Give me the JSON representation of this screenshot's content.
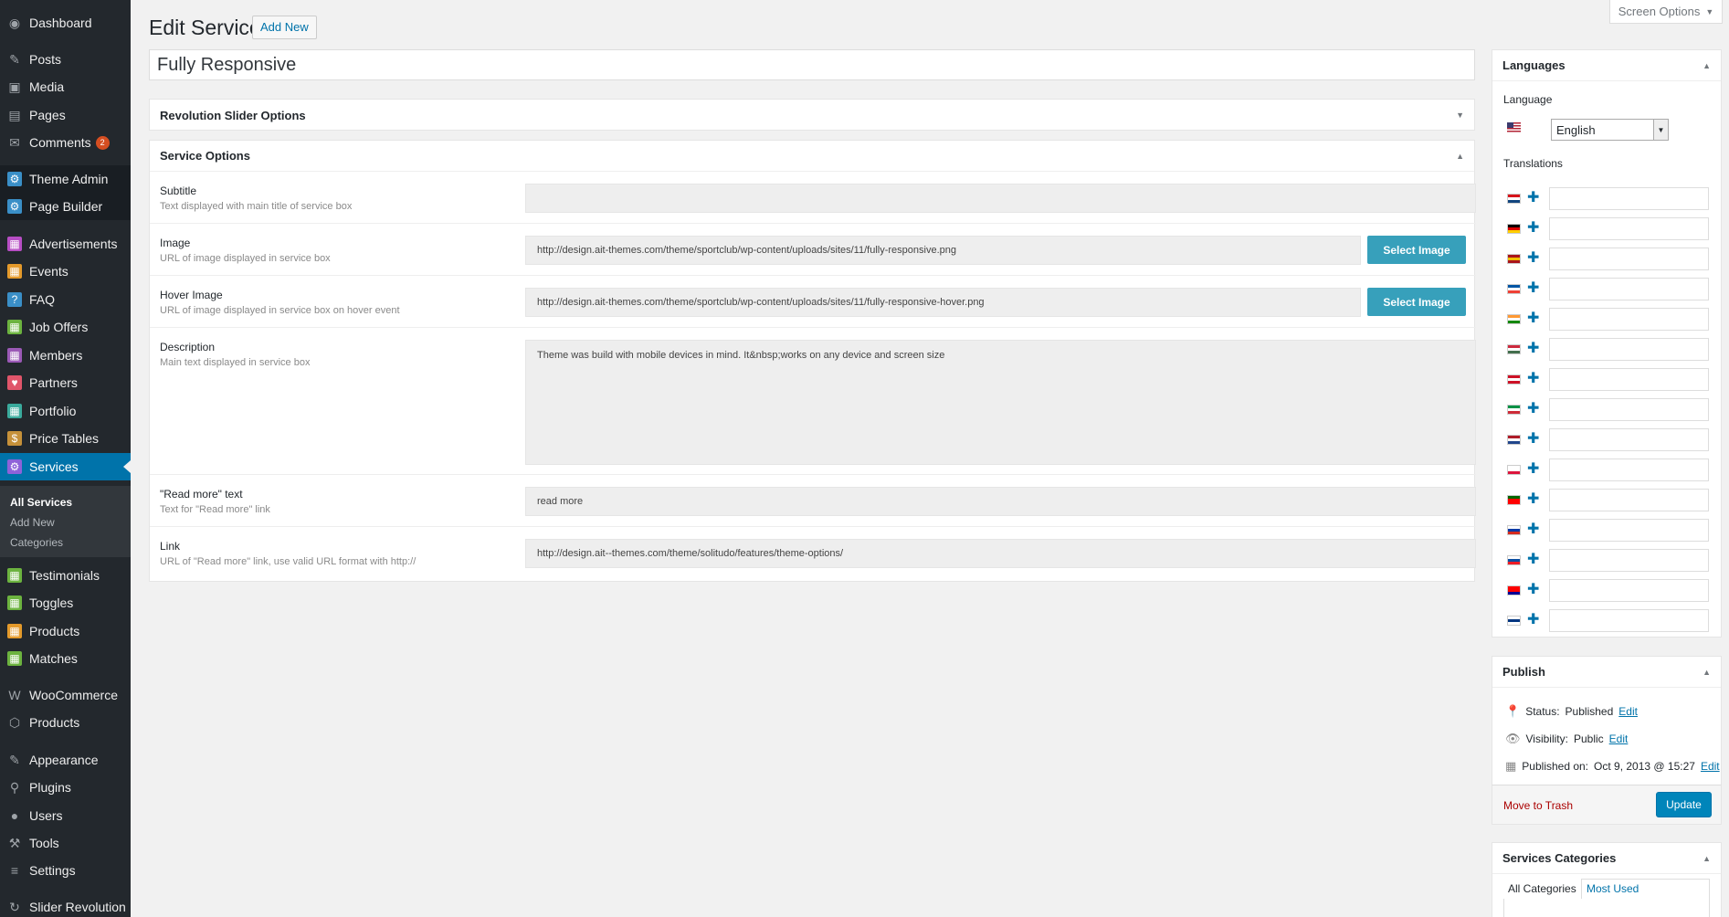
{
  "sidebar": {
    "items": [
      {
        "label": "Dashboard",
        "icon": "dashboard-icon",
        "color": "#9ea3a8"
      },
      {
        "label": "Posts",
        "icon": "pin-icon",
        "color": "#9ea3a8"
      },
      {
        "label": "Media",
        "icon": "media-icon",
        "color": "#9ea3a8"
      },
      {
        "label": "Pages",
        "icon": "pages-icon",
        "color": "#9ea3a8"
      },
      {
        "label": "Comments",
        "icon": "comments-icon",
        "color": "#9ea3a8",
        "badge": "2"
      },
      {
        "label": "Theme Admin",
        "icon": "theme-admin-icon",
        "color": "#3a8fc7"
      },
      {
        "label": "Page Builder",
        "icon": "page-builder-icon",
        "color": "#3a8fc7"
      },
      {
        "label": "Advertisements",
        "icon": "advertisements-icon",
        "color": "#b74ec4"
      },
      {
        "label": "Events",
        "icon": "events-icon",
        "color": "#e49a2b"
      },
      {
        "label": "FAQ",
        "icon": "faq-icon",
        "color": "#3a8fc7"
      },
      {
        "label": "Job Offers",
        "icon": "job-offers-icon",
        "color": "#6cb33f"
      },
      {
        "label": "Members",
        "icon": "members-icon",
        "color": "#9b59b6"
      },
      {
        "label": "Partners",
        "icon": "partners-icon",
        "color": "#e0556a"
      },
      {
        "label": "Portfolio",
        "icon": "portfolio-icon",
        "color": "#3aaa9c"
      },
      {
        "label": "Price Tables",
        "icon": "price-tables-icon",
        "color": "#c6913a"
      },
      {
        "label": "Services",
        "icon": "services-icon",
        "color": "#8e62d9"
      },
      {
        "label": "Testimonials",
        "icon": "testimonials-icon",
        "color": "#6cb33f"
      },
      {
        "label": "Toggles",
        "icon": "toggles-icon",
        "color": "#6cb33f"
      },
      {
        "label": "Products",
        "icon": "products-icon",
        "color": "#e49a2b"
      },
      {
        "label": "Matches",
        "icon": "matches-icon",
        "color": "#6cb33f"
      },
      {
        "label": "WooCommerce",
        "icon": "woocommerce-icon",
        "color": "#9ea3a8"
      },
      {
        "label": "Products",
        "icon": "box-icon",
        "color": "#9ea3a8"
      },
      {
        "label": "Appearance",
        "icon": "appearance-icon",
        "color": "#9ea3a8"
      },
      {
        "label": "Plugins",
        "icon": "plugins-icon",
        "color": "#9ea3a8"
      },
      {
        "label": "Users",
        "icon": "users-icon",
        "color": "#9ea3a8"
      },
      {
        "label": "Tools",
        "icon": "tools-icon",
        "color": "#9ea3a8"
      },
      {
        "label": "Settings",
        "icon": "settings-icon",
        "color": "#9ea3a8"
      },
      {
        "label": "Slider Revolution",
        "icon": "slider-revolution-icon",
        "color": "#9ea3a8"
      }
    ],
    "submenu": [
      "All Services",
      "Add New",
      "Categories"
    ]
  },
  "header": {
    "title": "Edit Service",
    "add_new": "Add New",
    "screen_options": "Screen Options"
  },
  "post_title": "Fully Responsive",
  "revslider_box": {
    "title": "Revolution Slider Options"
  },
  "service_options": {
    "title": "Service Options",
    "subtitle": {
      "label": "Subtitle",
      "desc": "Text displayed with main title of service box",
      "value": ""
    },
    "image": {
      "label": "Image",
      "desc": "URL of image displayed in service box",
      "value": "http://design.ait-themes.com/theme/sportclub/wp-content/uploads/sites/11/fully-responsive.png",
      "button": "Select Image"
    },
    "hover_image": {
      "label": "Hover Image",
      "desc": "URL of image displayed in service box on hover event",
      "value": "http://design.ait-themes.com/theme/sportclub/wp-content/uploads/sites/11/fully-responsive-hover.png",
      "button": "Select Image"
    },
    "description": {
      "label": "Description",
      "desc": "Main text displayed in service box",
      "value": "Theme was build with mobile devices in mind. It&nbsp;works on any device and screen size"
    },
    "read_more": {
      "label": "\"Read more\" text",
      "desc": "Text for \"Read more\" link",
      "value": "read more"
    },
    "link": {
      "label": "Link",
      "desc": "URL of \"Read more\" link, use valid URL format with http://",
      "value": "http://design.ait--themes.com/theme/solitudo/features/theme-options/"
    }
  },
  "languages": {
    "title": "Languages",
    "language_label": "Language",
    "selected": "English",
    "translations_label": "Translations",
    "flags": [
      [
        "#d7141a",
        "#ffffff",
        "#11457e"
      ],
      [
        "#000000",
        "#dd0000",
        "#ffce00"
      ],
      [
        "#aa151b",
        "#f1bf00",
        "#aa151b"
      ],
      [
        "#0055a4",
        "#ffffff",
        "#ef4135"
      ],
      [
        "#ff9933",
        "#ffffff",
        "#138808"
      ],
      [
        "#cd2a3e",
        "#ffffff",
        "#436f4d"
      ],
      [
        "#ce1126",
        "#ffffff",
        "#ce1126"
      ],
      [
        "#009246",
        "#ffffff",
        "#ce2b37"
      ],
      [
        "#ae1c28",
        "#ffffff",
        "#21468b"
      ],
      [
        "#ffffff",
        "#ffffff",
        "#dc143c"
      ],
      [
        "#006600",
        "#ff0000",
        "#ff0000"
      ],
      [
        "#ffffff",
        "#0039a6",
        "#d52b1e"
      ],
      [
        "#ffffff",
        "#0b4ea2",
        "#ee1c25"
      ],
      [
        "#fe0000",
        "#fe0000",
        "#000095"
      ],
      [
        "#ffffff",
        "#003580",
        "#ffffff"
      ]
    ]
  },
  "publish": {
    "title": "Publish",
    "status_label": "Status:",
    "status_value": "Published",
    "visibility_label": "Visibility:",
    "visibility_value": "Public",
    "published_label": "Published on:",
    "published_value": "Oct 9, 2013 @ 15:27",
    "edit": "Edit",
    "trash": "Move to Trash",
    "update": "Update"
  },
  "categories": {
    "title": "Services Categories",
    "tab_all": "All Categories",
    "tab_used": "Most Used"
  }
}
